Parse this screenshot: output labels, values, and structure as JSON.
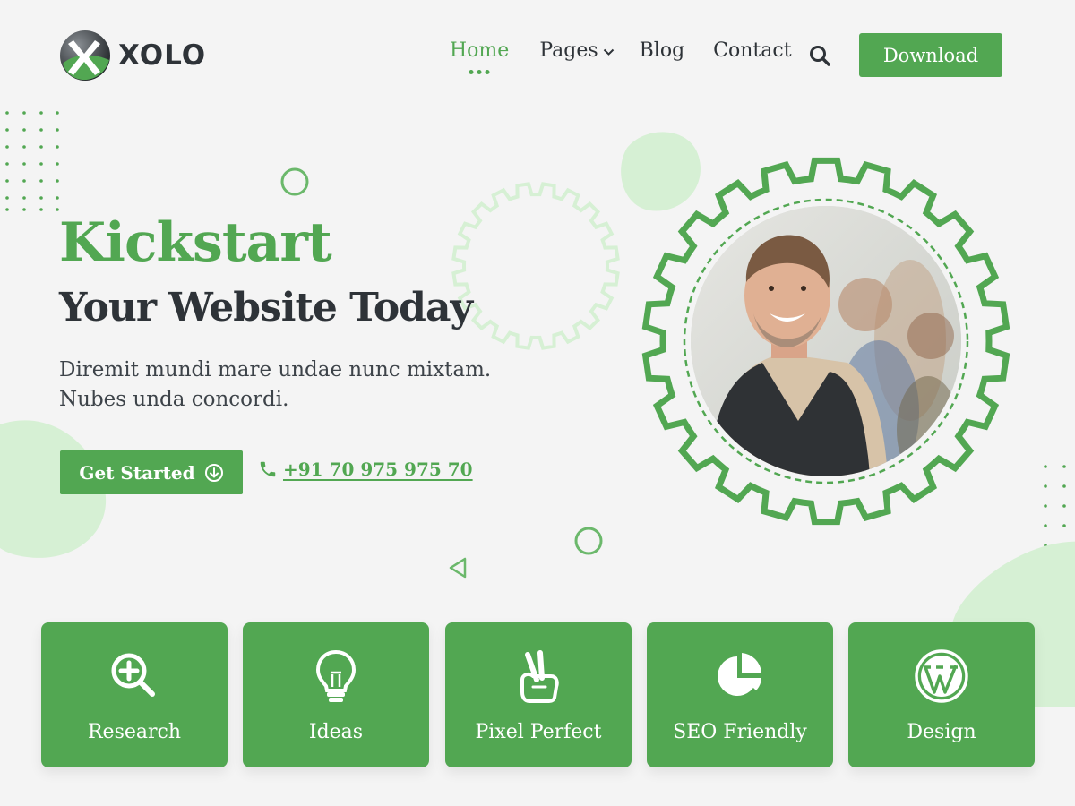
{
  "brand": {
    "name": "XOLO",
    "accent": "#52a752",
    "dark": "#2e3338",
    "light_accent": "#d6f0d4"
  },
  "nav": {
    "items": [
      {
        "label": "Home",
        "active": true
      },
      {
        "label": "Pages",
        "dropdown": true
      },
      {
        "label": "Blog"
      },
      {
        "label": "Contact"
      }
    ],
    "search_icon": "search-icon",
    "download_label": "Download"
  },
  "hero": {
    "title": "Kickstart",
    "subtitle": "Your Website Today",
    "description_line1": "Diremit mundi mare undae nunc mixtam.",
    "description_line2": "Nubes unda concordi.",
    "cta_label": "Get Started",
    "cta_icon": "arrow-down-circle-icon",
    "phone": "+91 70 975 975 70",
    "phone_icon": "phone-icon"
  },
  "portrait": {
    "icon": "gear-frame",
    "subject": "smiling-man-photo"
  },
  "features": [
    {
      "label": "Research",
      "icon": "search-plus-icon"
    },
    {
      "label": "Ideas",
      "icon": "lightbulb-icon"
    },
    {
      "label": "Pixel Perfect",
      "icon": "peace-hand-icon"
    },
    {
      "label": "SEO Friendly",
      "icon": "pie-chart-icon"
    },
    {
      "label": "Design",
      "icon": "wordpress-icon"
    }
  ]
}
